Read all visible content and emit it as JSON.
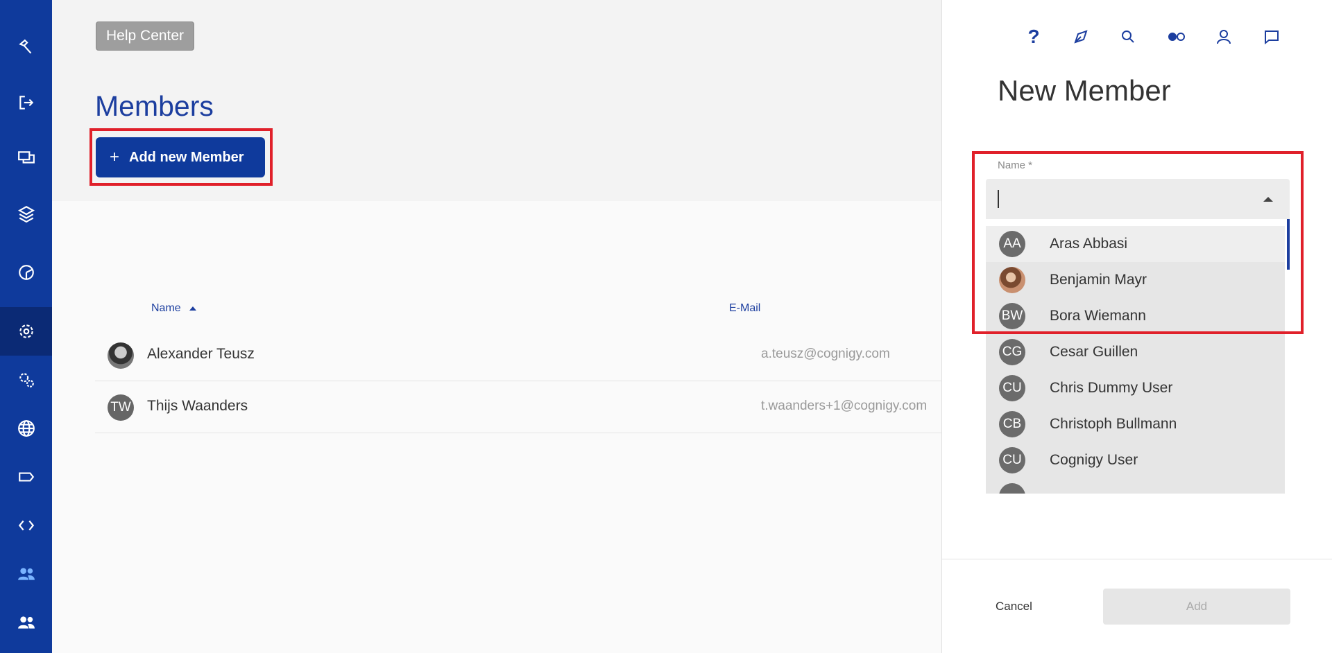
{
  "rail": {
    "icons": [
      "hammer-icon",
      "logout-icon",
      "chat-bubbles-icon",
      "layers-icon",
      "analytics-icon",
      "settings-icon",
      "settings-advanced-icon",
      "globe-icon",
      "tag-icon",
      "code-icon",
      "people-icon",
      "people-icon"
    ],
    "active": "settings-icon"
  },
  "header": {
    "help_label": "Help Center",
    "title": "Members",
    "add_button_label": "Add new Member",
    "add_button_icon": "plus-icon"
  },
  "table": {
    "columns": [
      "Name",
      "E-Mail"
    ],
    "rows": [
      {
        "name": "Alexander Teusz",
        "email": "a.teusz@cognigy.com",
        "avatar": "photo"
      },
      {
        "name": "Thijs Waanders",
        "email": "t.waanders+1@cognigy.com",
        "avatar": "TW"
      }
    ]
  },
  "panel": {
    "top_icons": [
      "help-icon",
      "compass-icon",
      "search-icon",
      "toggle-icon",
      "user-icon",
      "chat-icon"
    ],
    "title": "New Member",
    "field_label": "Name *",
    "field_value": "",
    "options": [
      {
        "initials": "AA",
        "name": "Aras Abbasi"
      },
      {
        "initials": "",
        "name": "Benjamin Mayr",
        "photo": true
      },
      {
        "initials": "BW",
        "name": "Bora Wiemann"
      },
      {
        "initials": "CG",
        "name": "Cesar Guillen"
      },
      {
        "initials": "CU",
        "name": "Chris Dummy User"
      },
      {
        "initials": "CB",
        "name": "Christoph Bullmann"
      },
      {
        "initials": "CU",
        "name": "Cognigy User"
      }
    ],
    "cancel_label": "Cancel",
    "submit_label": "Add"
  },
  "colors": {
    "brand": "#0f3a9c",
    "highlight": "#e0202a"
  }
}
